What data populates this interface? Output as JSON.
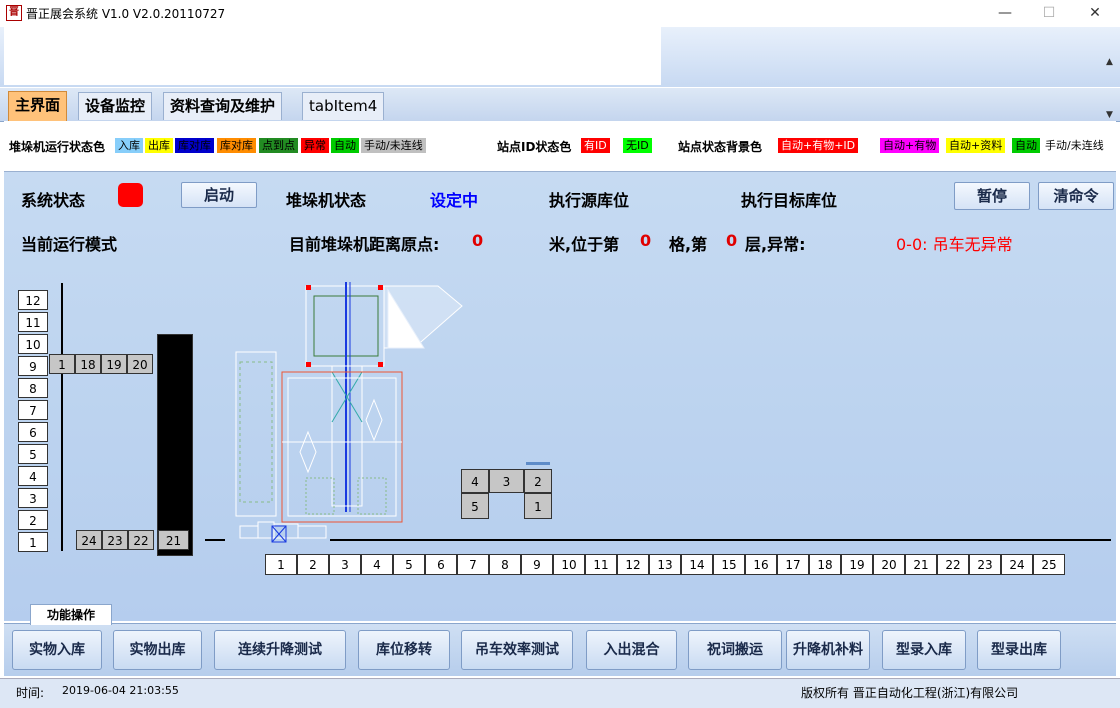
{
  "window": {
    "title": "晋正展会系统 V1.0 V2.0.20110727",
    "icon_glyph": "晋",
    "min": "—",
    "max": "☐",
    "close": "✕"
  },
  "scroll": {
    "up": "▲",
    "down": "▼"
  },
  "tabs": [
    "主界面",
    "设备监控",
    "资料查询及维护",
    "tabItem4"
  ],
  "legend": {
    "stacker_label": "堆垛机运行状态色",
    "stacker_items": [
      {
        "label": "入库",
        "bg": "#87cefa",
        "fg": "#000"
      },
      {
        "label": "出库",
        "bg": "#ffff00",
        "fg": "#000"
      },
      {
        "label": "库对库",
        "bg": "#0000cd",
        "fg": "#000"
      },
      {
        "label": "库对库",
        "bg": "#ff8c00",
        "fg": "#000"
      },
      {
        "label": "点到点",
        "bg": "#228b22",
        "fg": "#000"
      },
      {
        "label": "异常",
        "bg": "#ff0000",
        "fg": "#000"
      },
      {
        "label": "自动",
        "bg": "#00cc00",
        "fg": "#000"
      },
      {
        "label": "手动/未连线",
        "bg": "#c0c0c0",
        "fg": "#000"
      }
    ],
    "station_id_label": "站点ID状态色",
    "station_id_items": [
      {
        "label": "有ID",
        "bg": "#ff0000",
        "fg": "#fff"
      },
      {
        "label": "无ID",
        "bg": "#00ff00",
        "fg": "#000"
      }
    ],
    "station_bg_label": "站点状态背景色",
    "station_bg_items": [
      {
        "label": "自动+有物+ID",
        "bg": "#ff0000",
        "fg": "#fff"
      },
      {
        "label": "自动+有物",
        "bg": "#ff00ff",
        "fg": "#000"
      },
      {
        "label": "自动+资料",
        "bg": "#ffff00",
        "fg": "#000"
      },
      {
        "label": "自动",
        "bg": "#00cc00",
        "fg": "#000"
      },
      {
        "label": "手动/未连线",
        "bg": "#ffffff",
        "fg": "#000"
      }
    ]
  },
  "status": {
    "system_state_label": "系统状态",
    "start_button": "启动",
    "stacker_state_label": "堆垛机状态",
    "stacker_state_value": "设定中",
    "source_label": "执行源库位",
    "target_label": "执行目标库位",
    "pause_button": "暂停",
    "clear_button": "清命令",
    "mode_label": "当前运行模式",
    "distance_label": "目前堆垛机距离原点:",
    "distance_value": "0",
    "meter_label": "米,位于第",
    "col_value": "0",
    "col_label": "格,第",
    "layer_value": "0",
    "layer_label": "层,异常:",
    "error_text": "0-0:  吊车无异常",
    "indicator_color": "#ff0000"
  },
  "rack_left": [
    "12",
    "11",
    "10",
    "9",
    "8",
    "7",
    "6",
    "5",
    "4",
    "3",
    "2",
    "1"
  ],
  "rack_top_row": [
    "1",
    "18",
    "19",
    "20"
  ],
  "rack_bottom_row": [
    "24",
    "23",
    "22"
  ],
  "rack_black_label": "21",
  "stations": [
    "4",
    "3",
    "2",
    "5",
    "1"
  ],
  "columns": [
    "1",
    "2",
    "3",
    "4",
    "5",
    "6",
    "7",
    "8",
    "9",
    "10",
    "11",
    "12",
    "13",
    "14",
    "15",
    "16",
    "17",
    "18",
    "19",
    "20",
    "21",
    "22",
    "23",
    "24",
    "25"
  ],
  "func_tab": "功能操作",
  "func_buttons": [
    "实物入库",
    "实物出库",
    "连续升降测试",
    "库位移转",
    "吊车效率测试",
    "入出混合",
    "祝词搬运",
    "升降机补料",
    "型录入库",
    "型录出库"
  ],
  "statusbar": {
    "time_label": "时间:",
    "time_value": "2019-06-04 21:03:55",
    "copyright": "版权所有  晋正自动化工程(浙江)有限公司"
  }
}
